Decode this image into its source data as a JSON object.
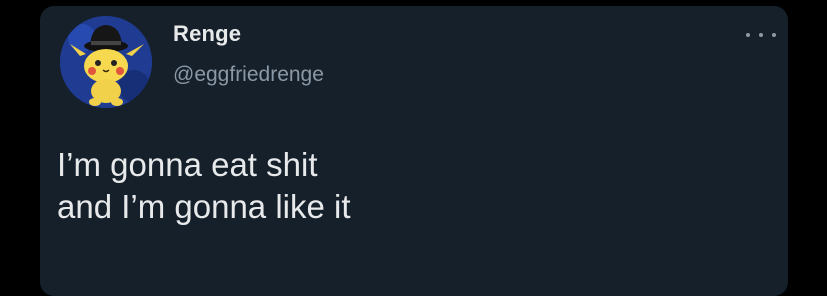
{
  "tweet": {
    "display_name": "Renge",
    "handle": "@eggfriedrenge",
    "text_lines": [
      "I’m gonna eat shit",
      "and I’m gonna like it"
    ],
    "avatar_icon": "pikachu-avatar-icon",
    "more_icon": "more-options-icon"
  },
  "colors": {
    "card_background": "#15202b",
    "page_background": "#000000",
    "primary_text": "#e7e9ea",
    "secondary_text": "#8b98a5",
    "avatar_background": "#1d3a8f"
  }
}
